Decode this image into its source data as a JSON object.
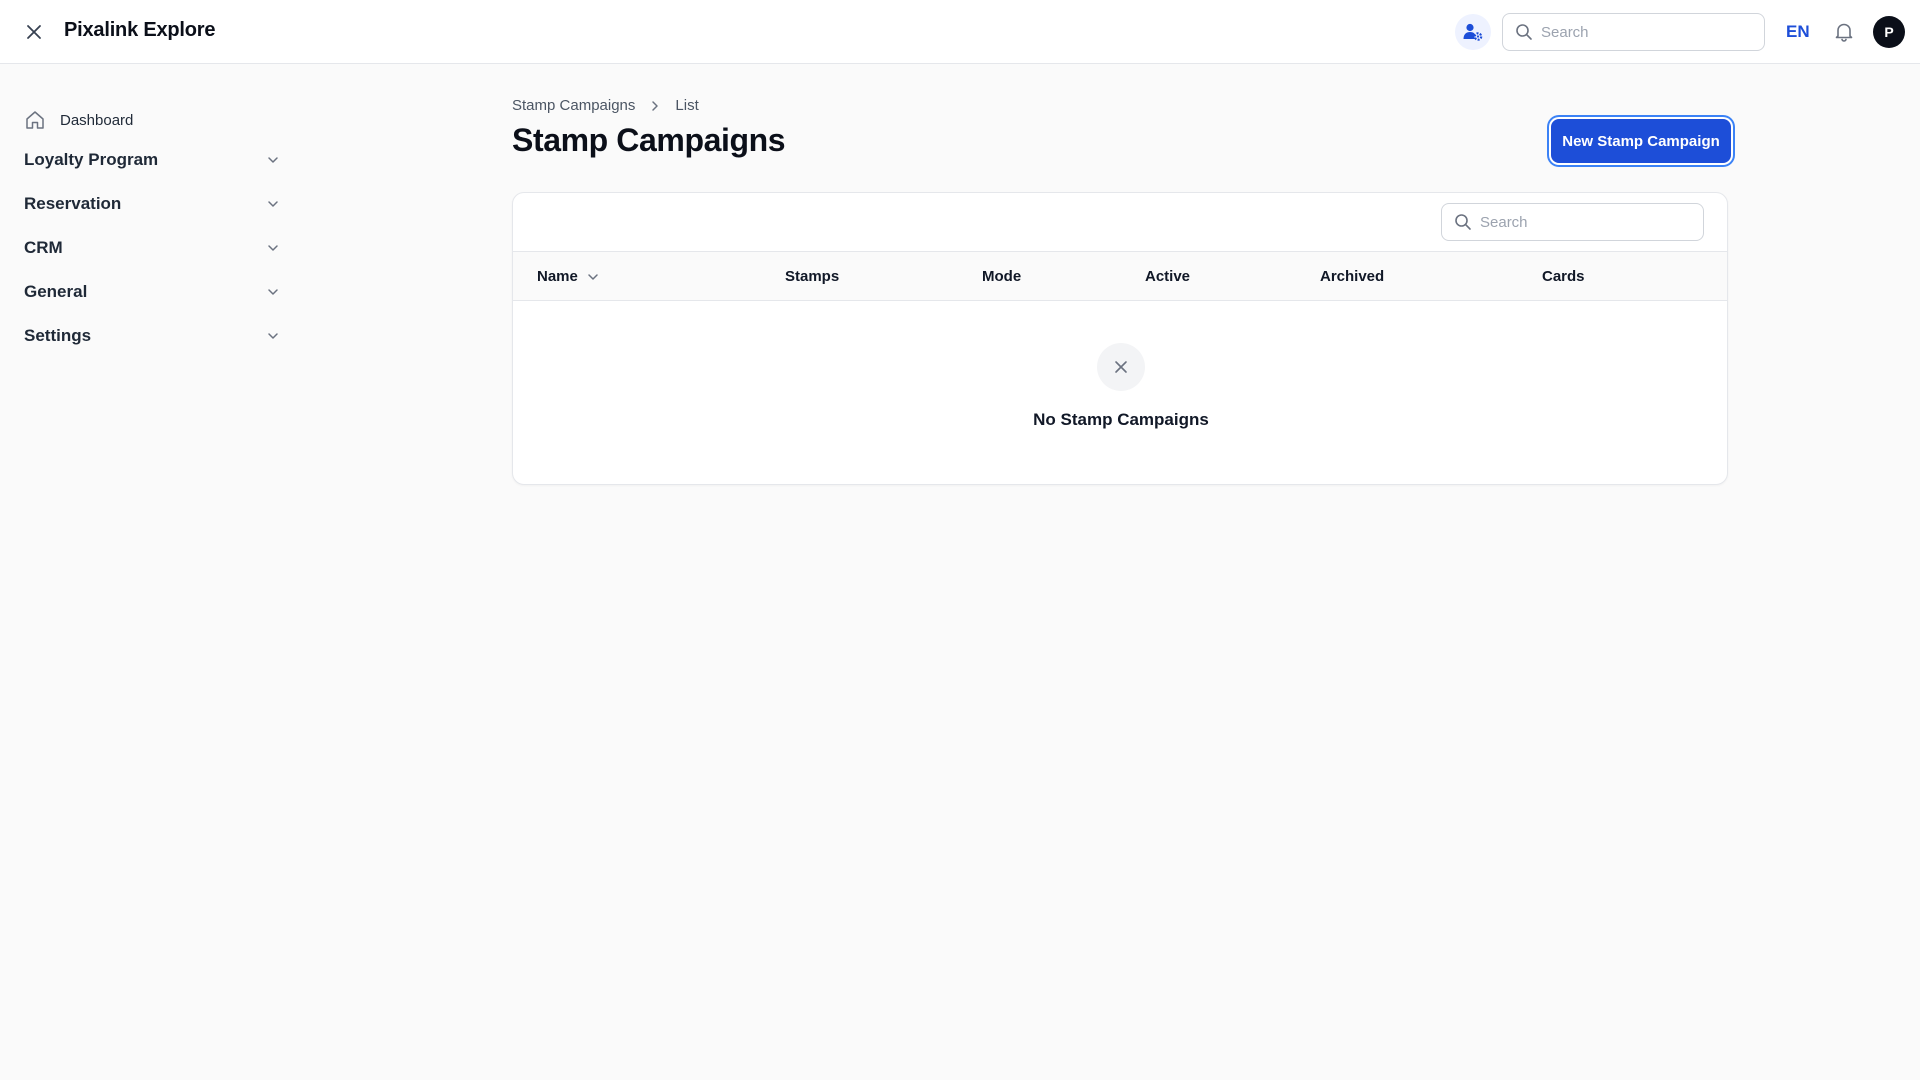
{
  "app": {
    "title": "Pixalink Explore"
  },
  "header": {
    "search_placeholder": "Search",
    "language": "EN",
    "avatar_initial": "P"
  },
  "sidebar": {
    "items": [
      {
        "label": "Dashboard",
        "icon": "home-icon"
      },
      {
        "label": "Loyalty Program",
        "icon": "chevron-down-icon"
      },
      {
        "label": "Reservation",
        "icon": "chevron-down-icon"
      },
      {
        "label": "CRM",
        "icon": "chevron-down-icon"
      },
      {
        "label": "General",
        "icon": "chevron-down-icon"
      },
      {
        "label": "Settings",
        "icon": "chevron-down-icon"
      }
    ]
  },
  "main": {
    "breadcrumb": [
      "Stamp Campaigns",
      "List"
    ],
    "title": "Stamp Campaigns",
    "new_button_label": "New Stamp Campaign",
    "table": {
      "search_placeholder": "Search",
      "columns": [
        "Name",
        "Stamps",
        "Mode",
        "Active",
        "Archived",
        "Cards"
      ],
      "empty_text": "No Stamp Campaigns"
    }
  },
  "colors": {
    "accent": "#1d4ed8",
    "background": "#fafafa",
    "text": "#111827"
  }
}
